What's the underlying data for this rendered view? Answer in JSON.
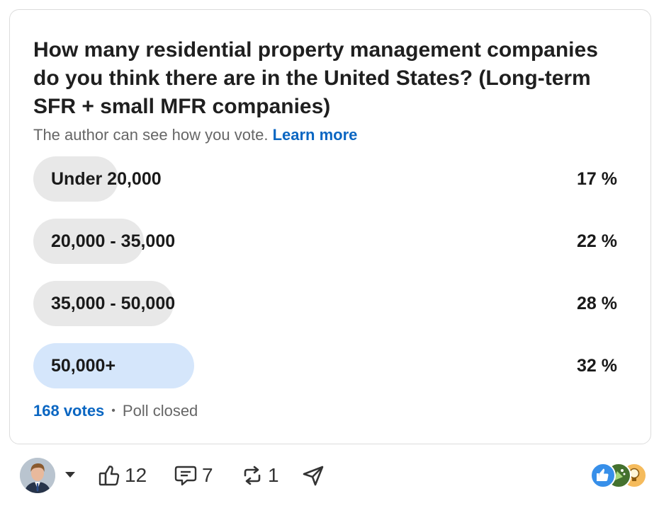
{
  "poll": {
    "question": "How many residential property management companies do you think there are in the United States? (Long-term SFR + small MFR companies)",
    "disclaimer": "The author can see how you vote.",
    "learn_more": "Learn more",
    "options": [
      {
        "label": "Under 20,000",
        "percent_text": "17 %",
        "percent": 17,
        "selected": false
      },
      {
        "label": "20,000 - 35,000",
        "percent_text": "22 %",
        "percent": 22,
        "selected": false
      },
      {
        "label": "35,000 - 50,000",
        "percent_text": "28 %",
        "percent": 28,
        "selected": false
      },
      {
        "label": "50,000+",
        "percent_text": "32 %",
        "percent": 32,
        "selected": true
      }
    ],
    "votes": "168 votes",
    "status": "Poll closed"
  },
  "actions": {
    "likes": "12",
    "comments": "7",
    "reposts": "1"
  },
  "colors": {
    "accent": "#0a66c2",
    "bar": "#e8e8e8",
    "bar_selected": "#d5e6fb"
  }
}
